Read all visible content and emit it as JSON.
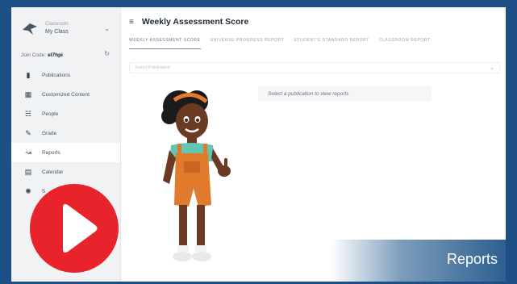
{
  "header": {
    "title": "Weekly Assessment Score"
  },
  "sidebar": {
    "class_caption": "Classroom",
    "class_name": "My Class",
    "join_code_label": "Join Code:",
    "join_code": "el7hpi",
    "items": [
      {
        "label": "Publications",
        "icon": "book-icon"
      },
      {
        "label": "Customized Content",
        "icon": "document-icon"
      },
      {
        "label": "People",
        "icon": "people-icon"
      },
      {
        "label": "Grade",
        "icon": "pencil-icon"
      },
      {
        "label": "Reports",
        "icon": "chart-icon",
        "active": true
      },
      {
        "label": "Calendar",
        "icon": "calendar-icon"
      },
      {
        "label": "S",
        "icon": "settings-icon"
      }
    ]
  },
  "tabs": [
    {
      "label": "WEEKLY ASSESSMENT SCORE",
      "active": true
    },
    {
      "label": "UNIVERSE PROGRESS REPORT"
    },
    {
      "label": "STUDENT'S STANDARD REPORT"
    },
    {
      "label": "CLASSROOM REPORT"
    }
  ],
  "select": {
    "placeholder": "Select Publication"
  },
  "notice": "Select a publication to view reports",
  "banner": {
    "label": "Reports"
  },
  "colors": {
    "frame": "#1d4f86",
    "play": "#e8232b",
    "banner": "#2d5f8f"
  }
}
